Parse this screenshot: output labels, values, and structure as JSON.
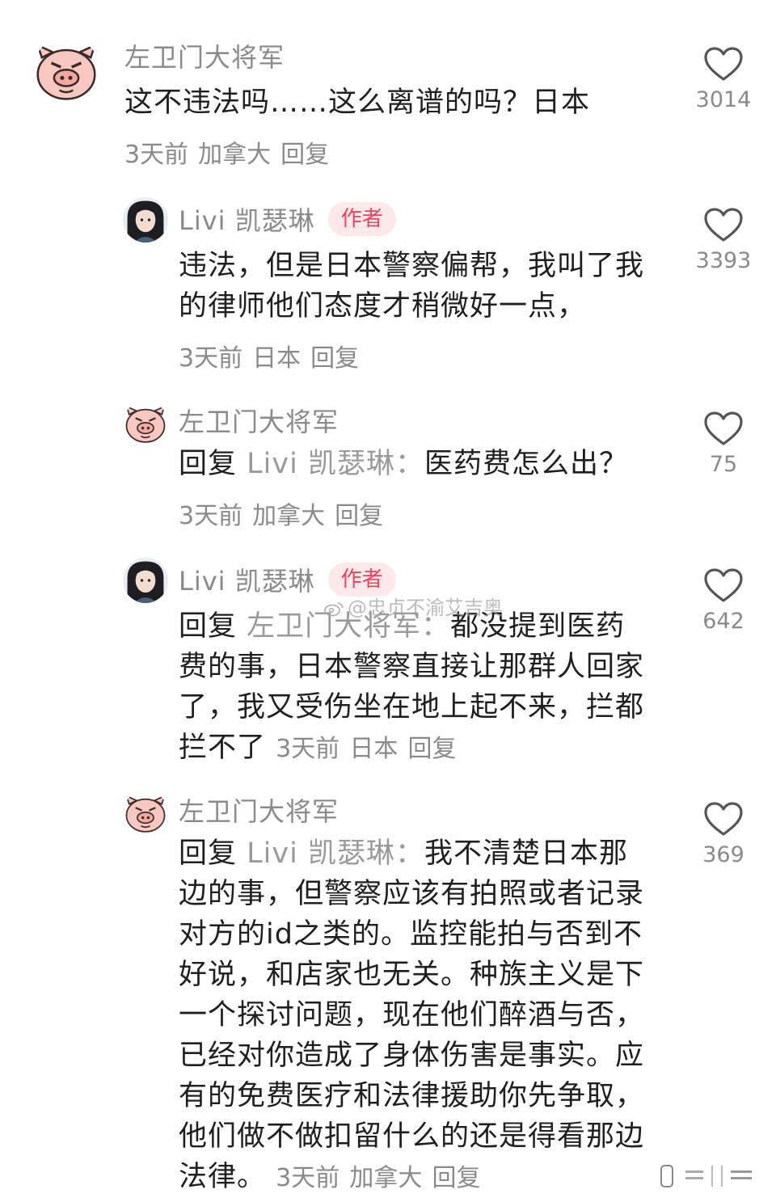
{
  "watermark": "@忠贞不渝艾吉奥",
  "comments": [
    {
      "user": "左卫门大将军",
      "text": "这不违法吗……这么离谱的吗？日本",
      "time": "3天前",
      "location": "加拿大",
      "reply_label": "回复",
      "likes": "3014",
      "avatar": "pig-avatar-icon"
    },
    {
      "user": "Livi 凯瑟琳",
      "badge": "作者",
      "text_lines": [
        "违法，但是日本警察偏帮，我叫了我",
        "的律师他们态度才稍微好一点，"
      ],
      "time": "3天前",
      "location": "日本",
      "reply_label": "回复",
      "likes": "3393",
      "avatar": "girl-avatar-icon"
    },
    {
      "user": "左卫门大将军",
      "reply_prefix": "回复",
      "mention": "Livi 凯瑟琳：",
      "text": "医药费怎么出？",
      "time": "3天前",
      "location": "加拿大",
      "reply_label": "回复",
      "likes": "75",
      "avatar": "pig-avatar-icon"
    },
    {
      "user": "Livi 凯瑟琳",
      "badge": "作者",
      "reply_prefix": "回复",
      "mention": "左卫门大将军：",
      "text_first": "都没提到医药",
      "text_lines": [
        "费的事，日本警察直接让那群人回家",
        "了，我又受伤坐在地上起不来，拦都"
      ],
      "text_last": "拦不了",
      "time": "3天前",
      "location": "日本",
      "reply_label": "回复",
      "likes": "642",
      "avatar": "girl-avatar-icon"
    },
    {
      "user": "左卫门大将军",
      "reply_prefix": "回复",
      "mention": "Livi 凯瑟琳：",
      "text_first": "我不清楚日本那",
      "text_lines": [
        "边的事，但警察应该有拍照或者记录",
        "对方的id之类的。监控能拍与否到不",
        "好说，和店家也无关。种族主义是下",
        "一个探讨问题，现在他们醉酒与否，",
        "已经对你造成了身体伤害是事实。应",
        "有的免费医疗和法律援助你先争取，",
        "他们做不做扣留什么的还是得看那边"
      ],
      "text_last": "法律。",
      "time": "3天前",
      "location": "加拿大",
      "reply_label": "回复",
      "likes": "369",
      "avatar": "pig-avatar-icon"
    }
  ]
}
